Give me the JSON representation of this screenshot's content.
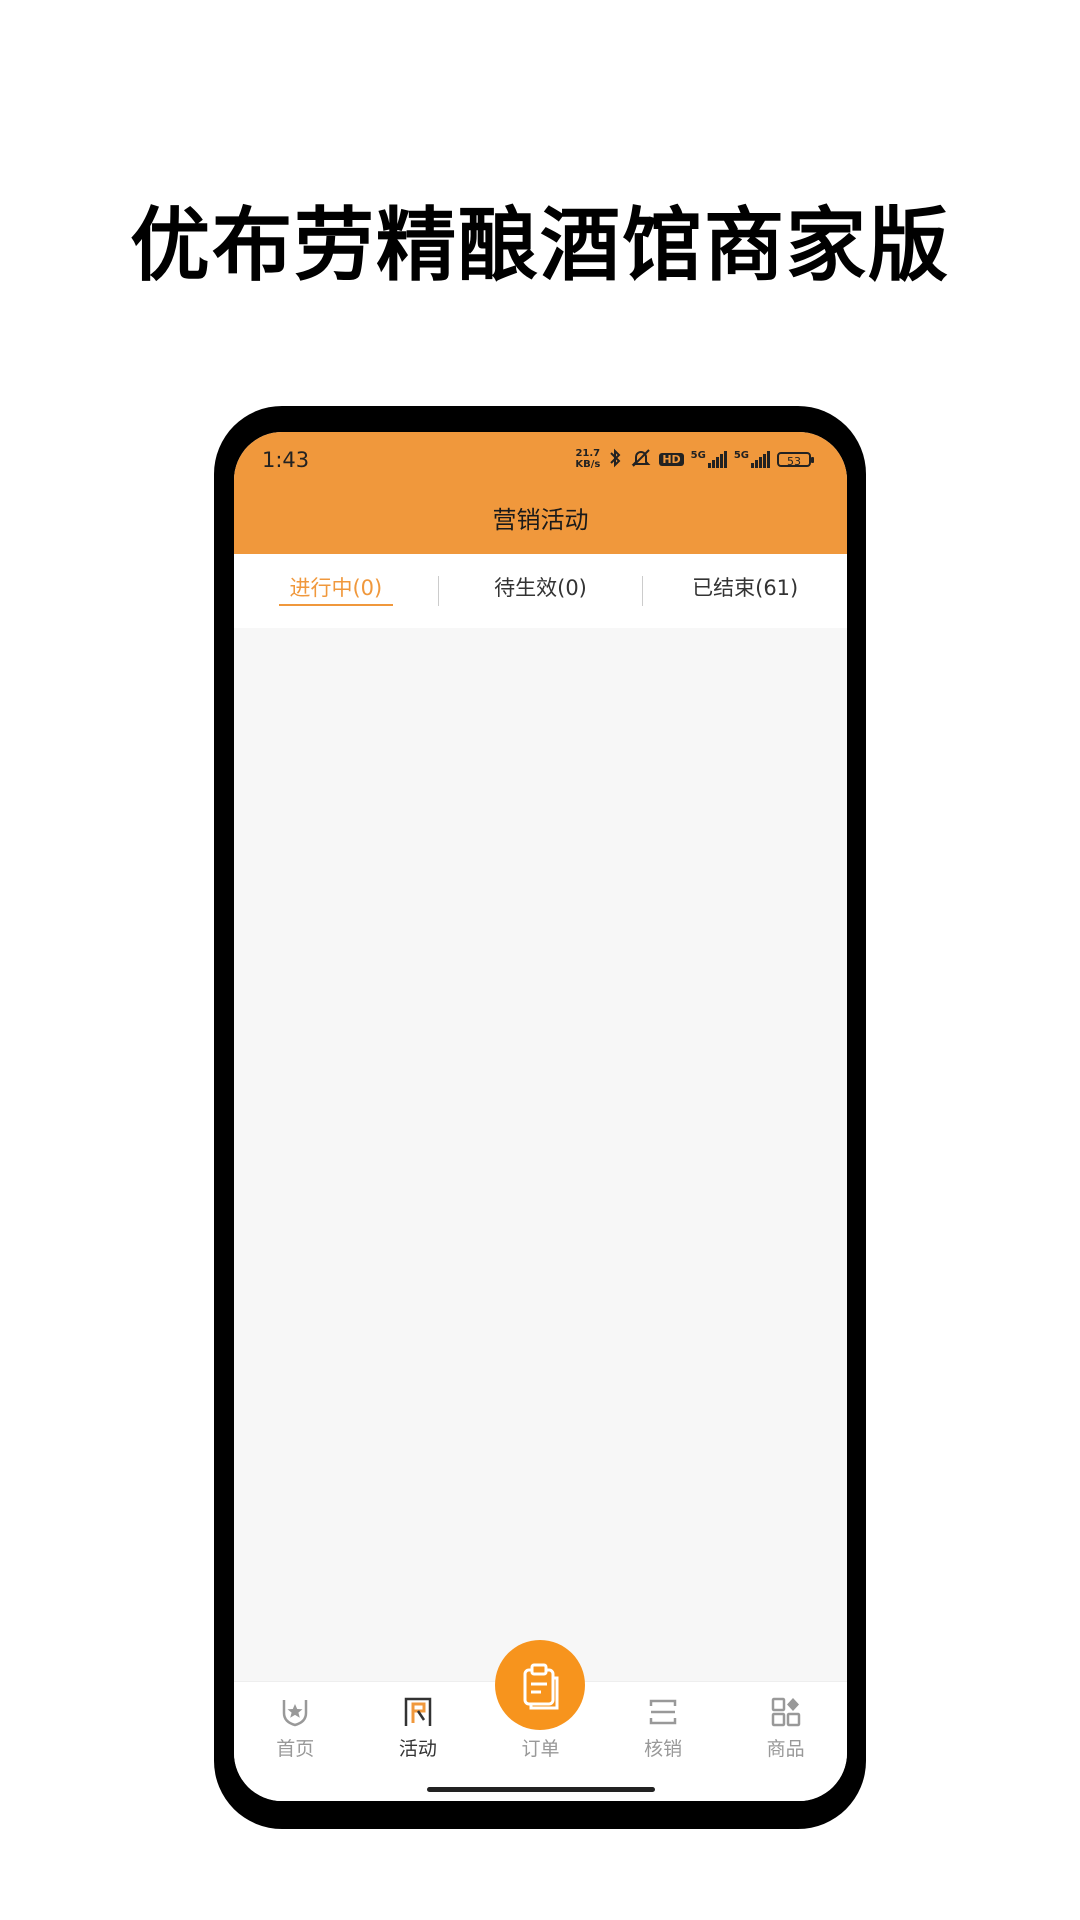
{
  "promo": {
    "title": "优布劳精酿酒馆商家版"
  },
  "statusbar": {
    "time": "1:43",
    "net_speed_value": "21.7",
    "net_speed_unit": "KB/s",
    "hd_label": "HD",
    "signal1_label": "5G",
    "signal2_label": "5G",
    "battery": "53"
  },
  "header": {
    "title": "营销活动"
  },
  "tabs": [
    {
      "label": "进行中(0)",
      "active": true
    },
    {
      "label": "待生效(0)",
      "active": false
    },
    {
      "label": "已结束(61)",
      "active": false
    }
  ],
  "bottom_nav": [
    {
      "label": "首页",
      "icon": "home-badge-icon"
    },
    {
      "label": "活动",
      "icon": "activity-flag-icon",
      "active": true
    },
    {
      "label": "订单",
      "icon": "clipboard-icon"
    },
    {
      "label": "核销",
      "icon": "scan-icon"
    },
    {
      "label": "商品",
      "icon": "grid-icon"
    }
  ],
  "colors": {
    "accent": "#f0983c",
    "center_button": "#f7941d"
  }
}
